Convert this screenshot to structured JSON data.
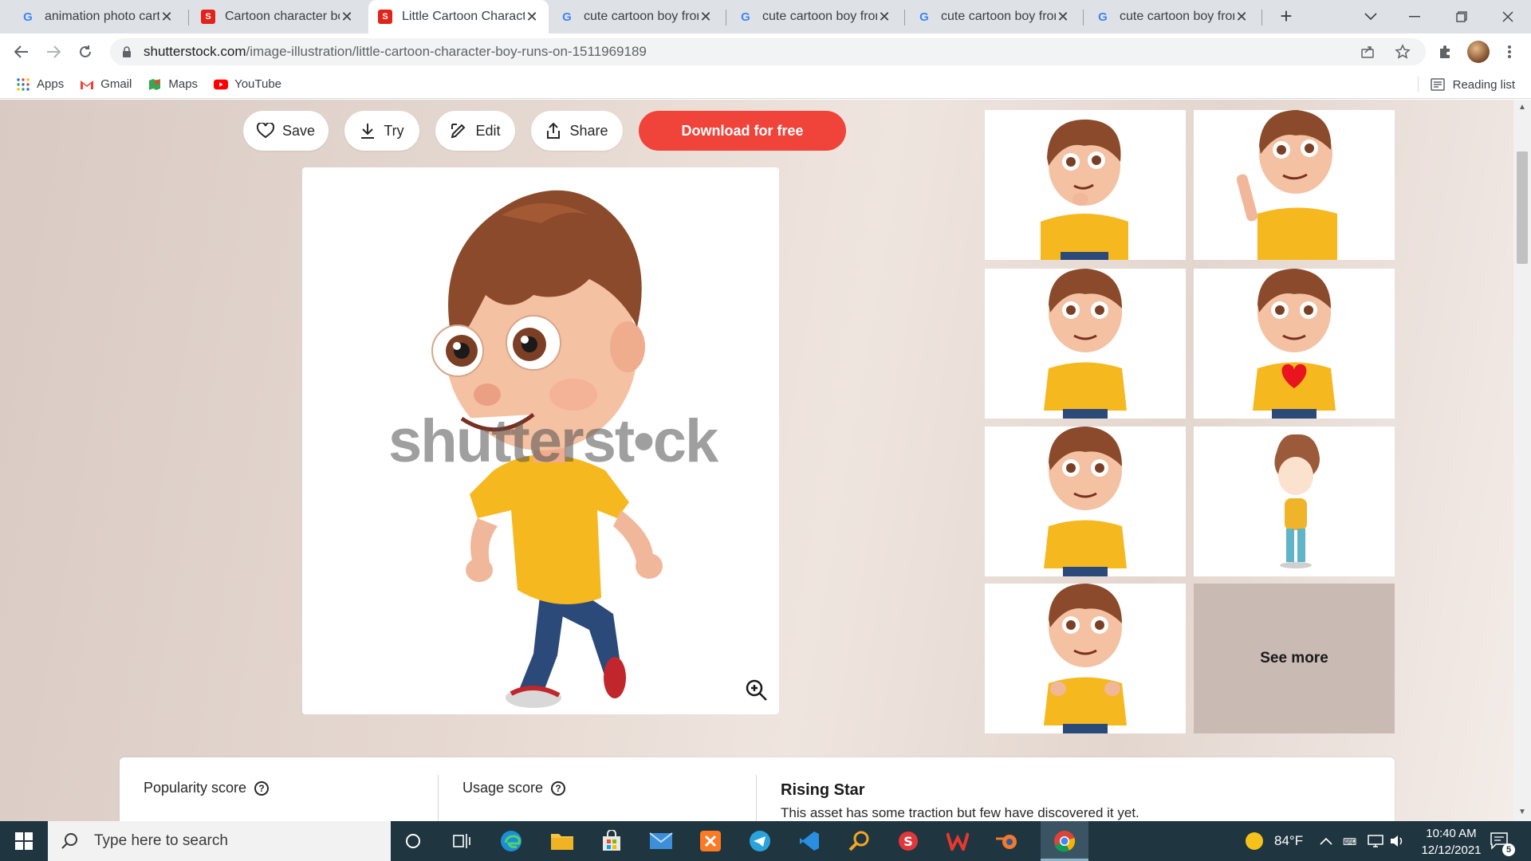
{
  "browser": {
    "tabs": [
      {
        "title": "animation photo carto",
        "icon": "google-icon",
        "active": false
      },
      {
        "title": "Cartoon character bo",
        "icon": "shutterstock-icon",
        "active": false
      },
      {
        "title": "Little Cartoon Charact",
        "icon": "shutterstock-icon",
        "active": true
      },
      {
        "title": "cute cartoon boy fron",
        "icon": "google-icon",
        "active": false
      },
      {
        "title": "cute cartoon boy fron",
        "icon": "google-icon",
        "active": false
      },
      {
        "title": "cute cartoon boy fron",
        "icon": "google-icon",
        "active": false
      },
      {
        "title": "cute cartoon boy fron",
        "icon": "google-icon",
        "active": false
      }
    ],
    "url_host": "shutterstock.com",
    "url_path": "/image-illustration/little-cartoon-character-boy-runs-on-1511969189"
  },
  "bookmarks": {
    "items": [
      {
        "label": "Apps",
        "icon": "apps-grid-icon"
      },
      {
        "label": "Gmail",
        "icon": "gmail-icon"
      },
      {
        "label": "Maps",
        "icon": "maps-icon"
      },
      {
        "label": "YouTube",
        "icon": "youtube-icon"
      }
    ],
    "reading_list": "Reading list"
  },
  "actions": {
    "save": "Save",
    "try": "Try",
    "edit": "Edit",
    "share": "Share",
    "download": "Download for free"
  },
  "main_image": {
    "watermark": "shutterst•ck"
  },
  "related": {
    "see_more": "See more"
  },
  "scores": {
    "popularity": "Popularity score",
    "usage": "Usage score",
    "rising_title": "Rising Star",
    "rising_desc": "This asset has some traction but few have discovered it yet."
  },
  "taskbar": {
    "search_placeholder": "Type here to search",
    "weather": "84°F",
    "time": "10:40 AM",
    "date": "12/12/2021",
    "notifications": "5"
  },
  "colors": {
    "accent": "#f0433a",
    "taskbar": "#1f3540"
  }
}
